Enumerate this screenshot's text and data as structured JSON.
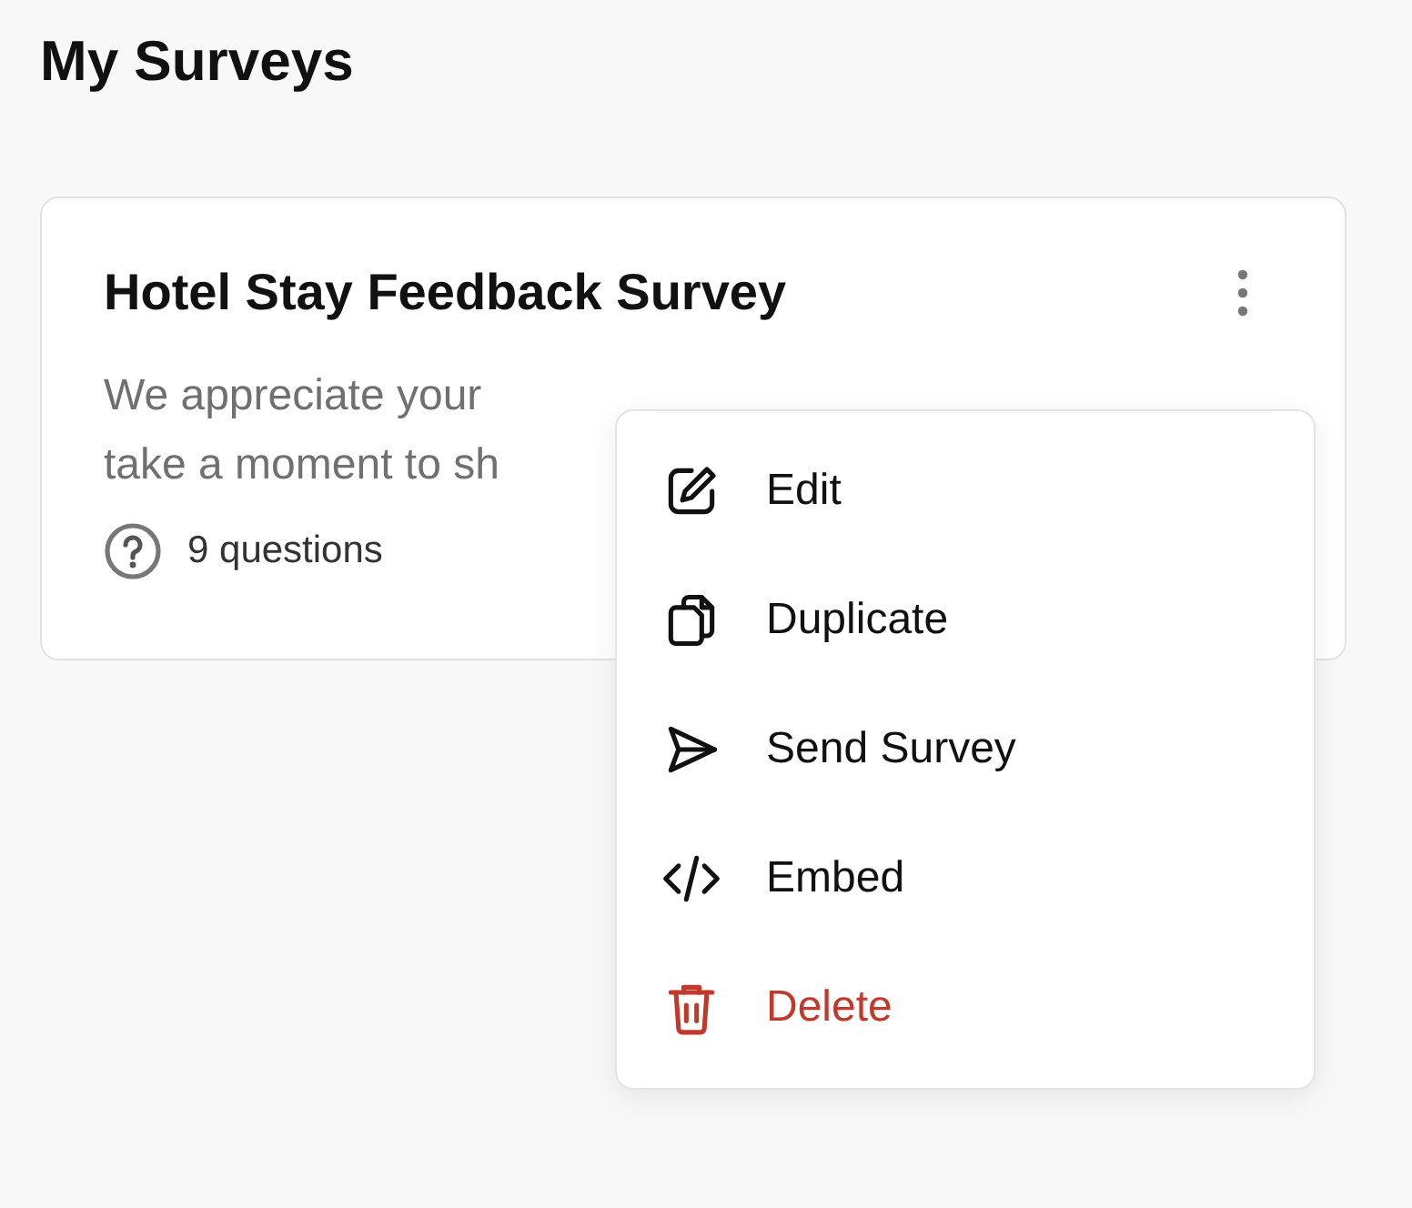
{
  "page": {
    "title": "My Surveys"
  },
  "survey_card": {
    "title": "Hotel Stay Feedback Survey",
    "description_lines": [
      "We appreciate your",
      "take a moment to sh"
    ],
    "question_count": "9 questions"
  },
  "context_menu": {
    "items": [
      {
        "kind": "edit",
        "label": "Edit"
      },
      {
        "kind": "duplicate",
        "label": "Duplicate"
      },
      {
        "kind": "send",
        "label": "Send Survey"
      },
      {
        "kind": "embed",
        "label": "Embed"
      },
      {
        "kind": "delete",
        "label": "Delete"
      }
    ]
  }
}
